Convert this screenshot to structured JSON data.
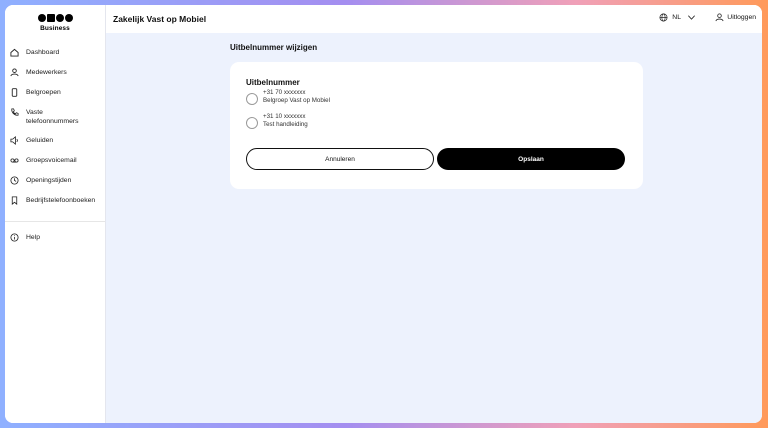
{
  "brand": {
    "sub": "Business"
  },
  "sidebar": {
    "items": [
      {
        "label": "Dashboard",
        "icon": "home-icon"
      },
      {
        "label": "Medewerkers",
        "icon": "user-icon"
      },
      {
        "label": "Belgroepen",
        "icon": "phone-device-icon"
      },
      {
        "label": "Vaste telefoonnummers",
        "icon": "phone-icon"
      },
      {
        "label": "Geluiden",
        "icon": "speaker-icon"
      },
      {
        "label": "Groepsvoicemail",
        "icon": "voicemail-icon"
      },
      {
        "label": "Openingstijden",
        "icon": "clock-icon"
      },
      {
        "label": "Bedrijfstelefoonboeken",
        "icon": "bookmark-icon"
      }
    ],
    "help": {
      "label": "Help",
      "icon": "info-icon"
    }
  },
  "header": {
    "title": "Zakelijk Vast op Mobiel",
    "language": "NL",
    "logout": "Uitloggen"
  },
  "main": {
    "page_title": "Uitbelnummer wijzigen",
    "card": {
      "title": "Uitbelnummer",
      "options": [
        {
          "number": "+31 70 xxxxxxx",
          "description": "Belgroep Vast op Mobiel",
          "selected": false
        },
        {
          "number": "+31 10 xxxxxxx",
          "description": "Test handleiding",
          "selected": false
        }
      ],
      "cancel_label": "Annuleren",
      "save_label": "Opslaan"
    }
  },
  "colors": {
    "primary_button": "#000000",
    "background": "#edf2fd",
    "card": "#ffffff"
  }
}
